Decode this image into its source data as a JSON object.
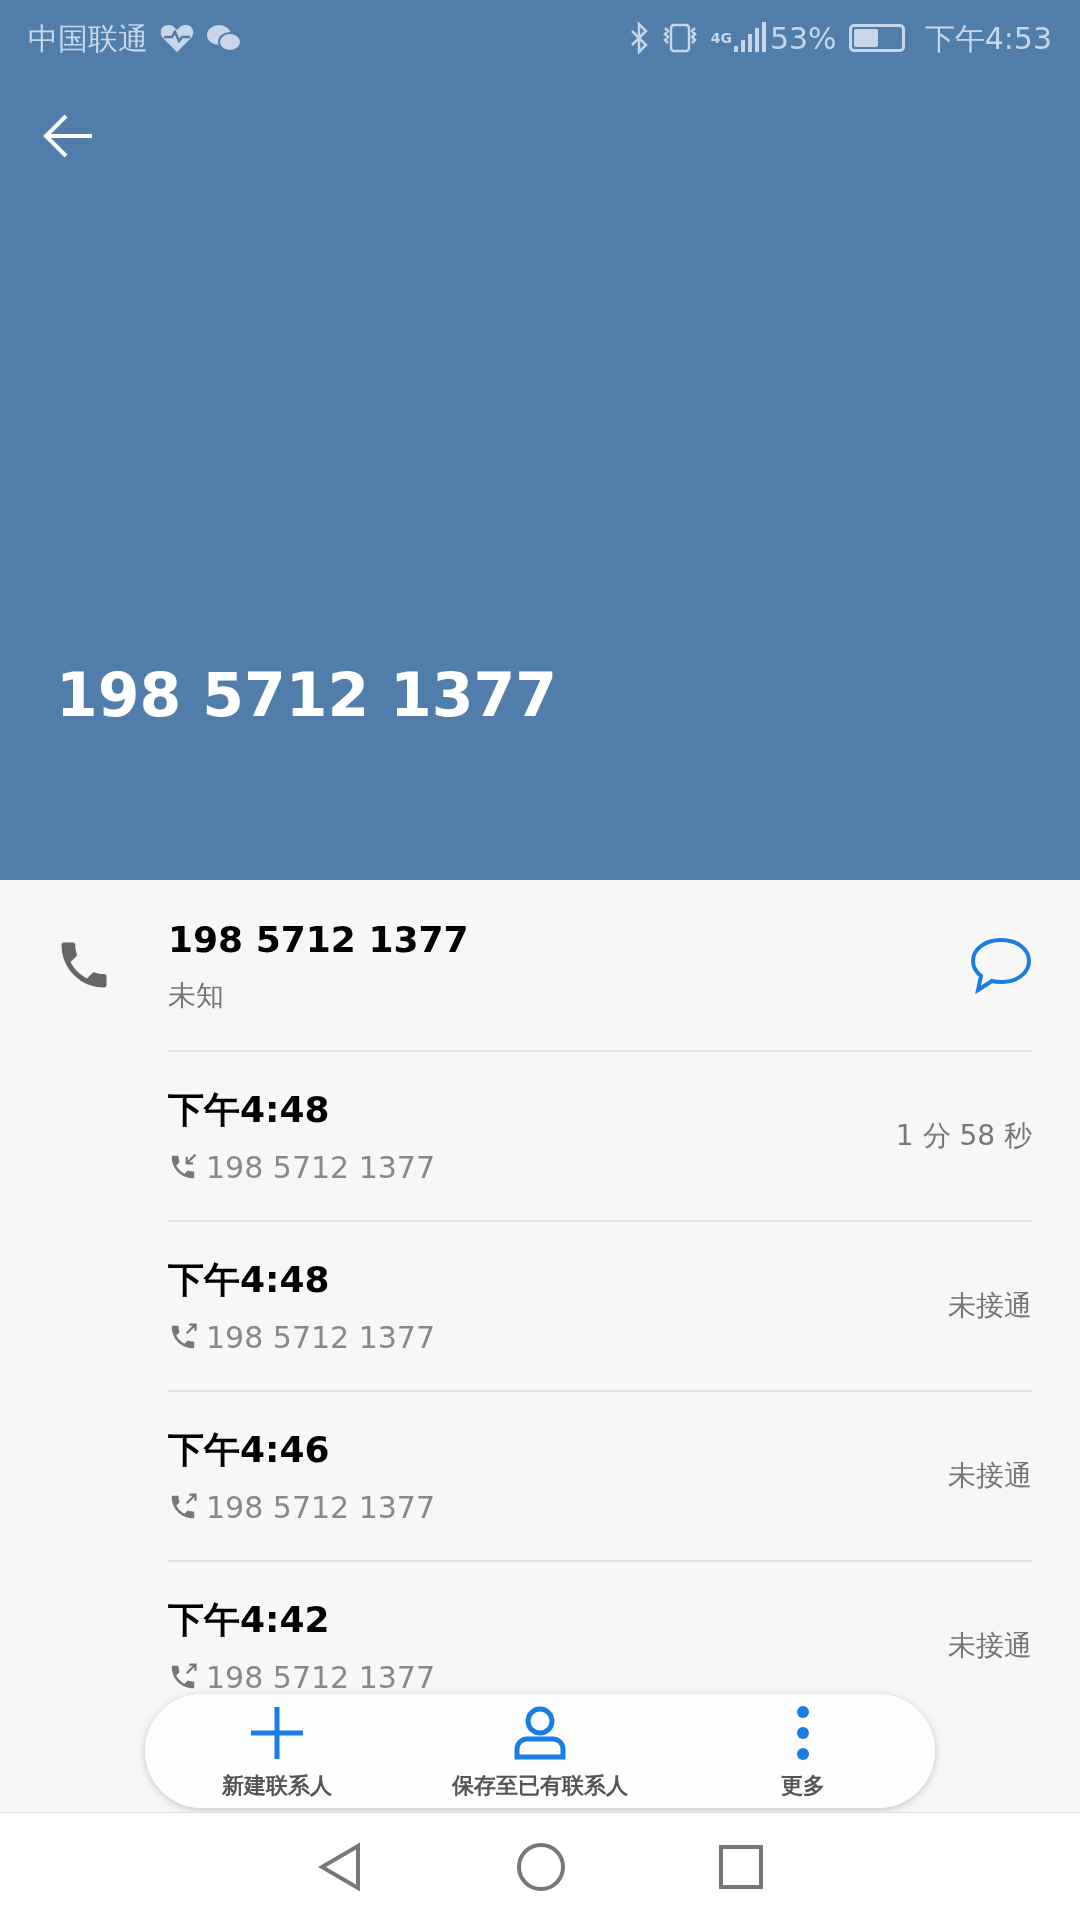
{
  "status_bar": {
    "carrier": "中国联通",
    "network": "4G",
    "battery": "53%",
    "time": "下午4:53"
  },
  "header": {
    "number": "198 5712 1377"
  },
  "contact": {
    "number": "198 5712 1377",
    "location": "未知"
  },
  "calls": [
    {
      "kind": "incoming",
      "time": "下午4:48",
      "number": "198 5712 1377",
      "detail": "1 分 58 秒"
    },
    {
      "kind": "outgoing",
      "time": "下午4:48",
      "number": "198 5712 1377",
      "detail": "未接通"
    },
    {
      "kind": "outgoing",
      "time": "下午4:46",
      "number": "198 5712 1377",
      "detail": "未接通"
    },
    {
      "kind": "outgoing",
      "time": "下午4:42",
      "number": "198 5712 1377",
      "detail": "未接通"
    }
  ],
  "toolbar": [
    {
      "kind": "add",
      "label": "新建联系人"
    },
    {
      "kind": "person",
      "label": "保存至已有联系人"
    },
    {
      "kind": "more",
      "label": "更多"
    }
  ]
}
